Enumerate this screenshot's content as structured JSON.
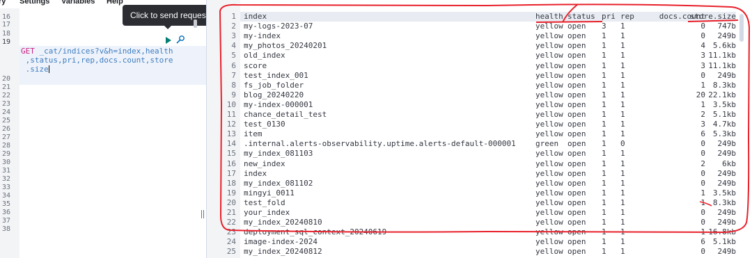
{
  "menu": [
    "ry",
    "Settings",
    "Variables",
    "Help"
  ],
  "tooltip": "Click to send request",
  "editor": {
    "line_numbers": [
      "16",
      "17",
      "18",
      "19",
      "",
      "",
      "20",
      "21",
      "22",
      "23",
      "24",
      "25",
      "26",
      "27",
      "28",
      "29",
      "30",
      "31",
      "32",
      "33",
      "34",
      "35",
      "36",
      "37",
      "38"
    ],
    "method": "GET",
    "request_lines": [
      " _cat/indices?v&h=index,health",
      " ,status,pri,rep,docs.count,store",
      " .size"
    ]
  },
  "output": {
    "columns": [
      "index",
      "health",
      "status",
      "pri",
      "rep",
      "docs.count",
      "store.size"
    ],
    "rows": [
      [
        "my-logs-2023-07",
        "yellow",
        "open",
        "3",
        "1",
        "0",
        "747b"
      ],
      [
        "my-index",
        "yellow",
        "open",
        "1",
        "1",
        "0",
        "249b"
      ],
      [
        "my_photos_20240201",
        "yellow",
        "open",
        "1",
        "1",
        "4",
        "5.6kb"
      ],
      [
        "old_index",
        "yellow",
        "open",
        "1",
        "1",
        "3",
        "11.1kb"
      ],
      [
        "score",
        "yellow",
        "open",
        "1",
        "1",
        "3",
        "11.1kb"
      ],
      [
        "test_index_001",
        "yellow",
        "open",
        "1",
        "1",
        "0",
        "249b"
      ],
      [
        "fs_job_folder",
        "yellow",
        "open",
        "1",
        "1",
        "1",
        "8.3kb"
      ],
      [
        "blog_20240220",
        "yellow",
        "open",
        "1",
        "1",
        "20",
        "22.1kb"
      ],
      [
        "my-index-000001",
        "yellow",
        "open",
        "1",
        "1",
        "1",
        "3.5kb"
      ],
      [
        "chance_detail_test",
        "yellow",
        "open",
        "1",
        "1",
        "2",
        "5.1kb"
      ],
      [
        "test_0130",
        "yellow",
        "open",
        "1",
        "1",
        "3",
        "4.7kb"
      ],
      [
        "item",
        "yellow",
        "open",
        "1",
        "1",
        "6",
        "5.3kb"
      ],
      [
        ".internal.alerts-observability.uptime.alerts-default-000001",
        "green",
        "open",
        "1",
        "0",
        "0",
        "249b"
      ],
      [
        "my_index_081103",
        "yellow",
        "open",
        "1",
        "1",
        "0",
        "249b"
      ],
      [
        "new_index",
        "yellow",
        "open",
        "1",
        "1",
        "2",
        "6kb"
      ],
      [
        "index",
        "yellow",
        "open",
        "1",
        "1",
        "0",
        "249b"
      ],
      [
        "my_index_081102",
        "yellow",
        "open",
        "1",
        "1",
        "0",
        "249b"
      ],
      [
        "mingyi_0011",
        "yellow",
        "open",
        "1",
        "1",
        "1",
        "3.5kb"
      ],
      [
        "test_fold",
        "yellow",
        "open",
        "1",
        "1",
        "1",
        "8.3kb"
      ],
      [
        "your_index",
        "yellow",
        "open",
        "1",
        "1",
        "0",
        "249b"
      ],
      [
        "my_index_20240810",
        "yellow",
        "open",
        "1",
        "1",
        "0",
        "249b"
      ],
      [
        "deployment_sql_context_20240619",
        "yellow",
        "open",
        "1",
        "1",
        "1",
        "16.8kb"
      ],
      [
        "image-index-2024",
        "yellow",
        "open",
        "1",
        "1",
        "6",
        "5.1kb"
      ],
      [
        "my_index_20240812",
        "yellow",
        "open",
        "1",
        "1",
        "0",
        "249b"
      ]
    ]
  },
  "colors": {
    "annotation": "#e8202a",
    "method": "#c81e7d",
    "request": "#3d7bbf",
    "play": "#017d73"
  }
}
